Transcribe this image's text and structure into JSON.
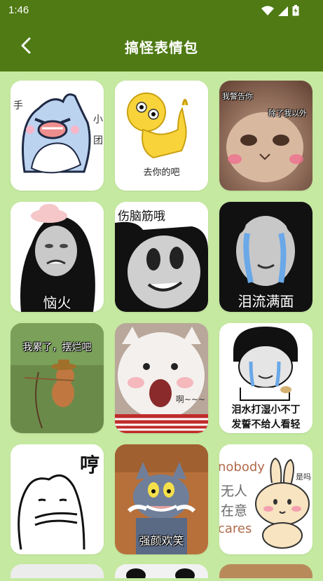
{
  "status_bar": {
    "time": "1:46",
    "icons": [
      "wifi-icon",
      "signal-icon",
      "battery-icon"
    ]
  },
  "app_bar": {
    "title": "搞怪表情包",
    "back_icon": "chevron-left-icon"
  },
  "colors": {
    "header": "#4f7a14",
    "background": "#c5e9a0",
    "card": "#ffffff"
  },
  "stickers": [
    {
      "name": "shark",
      "caption": ""
    },
    {
      "name": "yellow-figure",
      "caption": "去你的吧"
    },
    {
      "name": "cat-warning",
      "caption_top": "我警告你",
      "caption_right": "除了我以外"
    },
    {
      "name": "annoyed",
      "caption": "恼火"
    },
    {
      "name": "hurt-brain",
      "caption": "伤脑筋哦"
    },
    {
      "name": "tears",
      "caption": "泪流满面"
    },
    {
      "name": "jerry",
      "caption": "我累了，摆烂吧"
    },
    {
      "name": "fluffy-cat",
      "caption": "啊~~~"
    },
    {
      "name": "crying-boy",
      "caption_line1": "泪水打湿小不丁",
      "caption_line2": "发誓不给人看轻"
    },
    {
      "name": "hum",
      "caption": "哼"
    },
    {
      "name": "tom",
      "caption": "强颜欢笑"
    },
    {
      "name": "bunny",
      "caption_en1": "nobody",
      "caption_cn1": "无人",
      "caption_cn2": "在意",
      "caption_en2": "cares",
      "caption_side": "是吗"
    }
  ]
}
